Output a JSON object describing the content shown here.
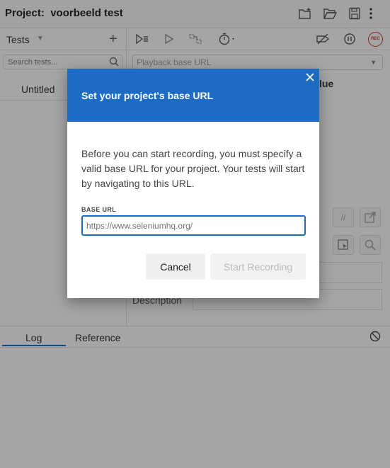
{
  "titlebar": {
    "project_label": "Project:",
    "project_name": "voorbeeld test",
    "icons": [
      "new-folder-icon",
      "open-folder-icon",
      "save-icon",
      "more-vertical-icon"
    ]
  },
  "tests_panel": {
    "header_label": "Tests",
    "add_symbol": "+",
    "search_placeholder": "Search tests...",
    "selected_test": "Untitled"
  },
  "editor": {
    "toolbar_icons": [
      "run-all-icon",
      "play-icon",
      "step-icon",
      "timer-icon",
      "disable-breakpoints-icon",
      "pause-icon"
    ],
    "rec_label": "REC",
    "base_url_placeholder": "Playback base URL",
    "value_header": "lue",
    "description_label": "Description",
    "comment_symbol": "//"
  },
  "bottom_panel": {
    "tabs": [
      {
        "label": "Log",
        "active": true
      },
      {
        "label": "Reference",
        "active": false
      }
    ]
  },
  "modal": {
    "title": "Set your project's base URL",
    "body": "Before you can start recording, you must specify a valid base URL for your project. Your tests will start by navigating to this URL.",
    "field_label": "BASE URL",
    "field_placeholder": "https://www.seleniumhq.org/",
    "field_value": "",
    "cancel_label": "Cancel",
    "start_label": "Start Recording"
  },
  "colors": {
    "accent": "#1e6bc4",
    "rec": "#c0392b"
  }
}
